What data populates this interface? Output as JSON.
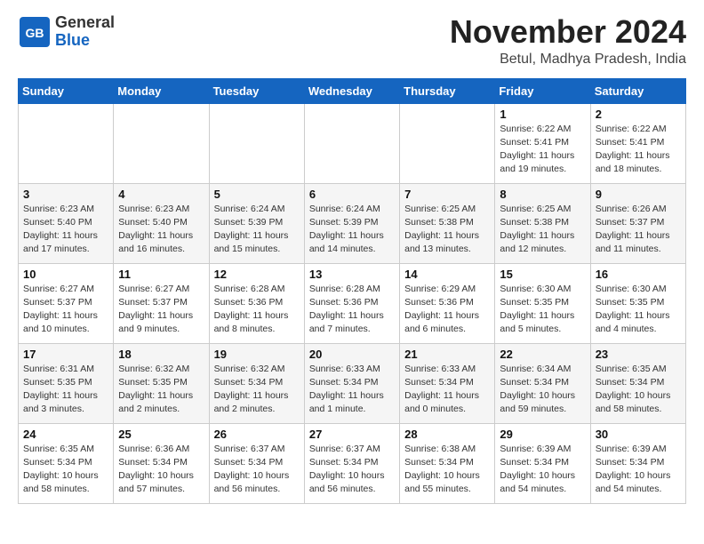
{
  "logo": {
    "line1": "General",
    "line2": "Blue"
  },
  "title": "November 2024",
  "location": "Betul, Madhya Pradesh, India",
  "days_header": [
    "Sunday",
    "Monday",
    "Tuesday",
    "Wednesday",
    "Thursday",
    "Friday",
    "Saturday"
  ],
  "weeks": [
    [
      {
        "day": "",
        "detail": ""
      },
      {
        "day": "",
        "detail": ""
      },
      {
        "day": "",
        "detail": ""
      },
      {
        "day": "",
        "detail": ""
      },
      {
        "day": "",
        "detail": ""
      },
      {
        "day": "1",
        "detail": "Sunrise: 6:22 AM\nSunset: 5:41 PM\nDaylight: 11 hours\nand 19 minutes."
      },
      {
        "day": "2",
        "detail": "Sunrise: 6:22 AM\nSunset: 5:41 PM\nDaylight: 11 hours\nand 18 minutes."
      }
    ],
    [
      {
        "day": "3",
        "detail": "Sunrise: 6:23 AM\nSunset: 5:40 PM\nDaylight: 11 hours\nand 17 minutes."
      },
      {
        "day": "4",
        "detail": "Sunrise: 6:23 AM\nSunset: 5:40 PM\nDaylight: 11 hours\nand 16 minutes."
      },
      {
        "day": "5",
        "detail": "Sunrise: 6:24 AM\nSunset: 5:39 PM\nDaylight: 11 hours\nand 15 minutes."
      },
      {
        "day": "6",
        "detail": "Sunrise: 6:24 AM\nSunset: 5:39 PM\nDaylight: 11 hours\nand 14 minutes."
      },
      {
        "day": "7",
        "detail": "Sunrise: 6:25 AM\nSunset: 5:38 PM\nDaylight: 11 hours\nand 13 minutes."
      },
      {
        "day": "8",
        "detail": "Sunrise: 6:25 AM\nSunset: 5:38 PM\nDaylight: 11 hours\nand 12 minutes."
      },
      {
        "day": "9",
        "detail": "Sunrise: 6:26 AM\nSunset: 5:37 PM\nDaylight: 11 hours\nand 11 minutes."
      }
    ],
    [
      {
        "day": "10",
        "detail": "Sunrise: 6:27 AM\nSunset: 5:37 PM\nDaylight: 11 hours\nand 10 minutes."
      },
      {
        "day": "11",
        "detail": "Sunrise: 6:27 AM\nSunset: 5:37 PM\nDaylight: 11 hours\nand 9 minutes."
      },
      {
        "day": "12",
        "detail": "Sunrise: 6:28 AM\nSunset: 5:36 PM\nDaylight: 11 hours\nand 8 minutes."
      },
      {
        "day": "13",
        "detail": "Sunrise: 6:28 AM\nSunset: 5:36 PM\nDaylight: 11 hours\nand 7 minutes."
      },
      {
        "day": "14",
        "detail": "Sunrise: 6:29 AM\nSunset: 5:36 PM\nDaylight: 11 hours\nand 6 minutes."
      },
      {
        "day": "15",
        "detail": "Sunrise: 6:30 AM\nSunset: 5:35 PM\nDaylight: 11 hours\nand 5 minutes."
      },
      {
        "day": "16",
        "detail": "Sunrise: 6:30 AM\nSunset: 5:35 PM\nDaylight: 11 hours\nand 4 minutes."
      }
    ],
    [
      {
        "day": "17",
        "detail": "Sunrise: 6:31 AM\nSunset: 5:35 PM\nDaylight: 11 hours\nand 3 minutes."
      },
      {
        "day": "18",
        "detail": "Sunrise: 6:32 AM\nSunset: 5:35 PM\nDaylight: 11 hours\nand 2 minutes."
      },
      {
        "day": "19",
        "detail": "Sunrise: 6:32 AM\nSunset: 5:34 PM\nDaylight: 11 hours\nand 2 minutes."
      },
      {
        "day": "20",
        "detail": "Sunrise: 6:33 AM\nSunset: 5:34 PM\nDaylight: 11 hours\nand 1 minute."
      },
      {
        "day": "21",
        "detail": "Sunrise: 6:33 AM\nSunset: 5:34 PM\nDaylight: 11 hours\nand 0 minutes."
      },
      {
        "day": "22",
        "detail": "Sunrise: 6:34 AM\nSunset: 5:34 PM\nDaylight: 10 hours\nand 59 minutes."
      },
      {
        "day": "23",
        "detail": "Sunrise: 6:35 AM\nSunset: 5:34 PM\nDaylight: 10 hours\nand 58 minutes."
      }
    ],
    [
      {
        "day": "24",
        "detail": "Sunrise: 6:35 AM\nSunset: 5:34 PM\nDaylight: 10 hours\nand 58 minutes."
      },
      {
        "day": "25",
        "detail": "Sunrise: 6:36 AM\nSunset: 5:34 PM\nDaylight: 10 hours\nand 57 minutes."
      },
      {
        "day": "26",
        "detail": "Sunrise: 6:37 AM\nSunset: 5:34 PM\nDaylight: 10 hours\nand 56 minutes."
      },
      {
        "day": "27",
        "detail": "Sunrise: 6:37 AM\nSunset: 5:34 PM\nDaylight: 10 hours\nand 56 minutes."
      },
      {
        "day": "28",
        "detail": "Sunrise: 6:38 AM\nSunset: 5:34 PM\nDaylight: 10 hours\nand 55 minutes."
      },
      {
        "day": "29",
        "detail": "Sunrise: 6:39 AM\nSunset: 5:34 PM\nDaylight: 10 hours\nand 54 minutes."
      },
      {
        "day": "30",
        "detail": "Sunrise: 6:39 AM\nSunset: 5:34 PM\nDaylight: 10 hours\nand 54 minutes."
      }
    ]
  ]
}
